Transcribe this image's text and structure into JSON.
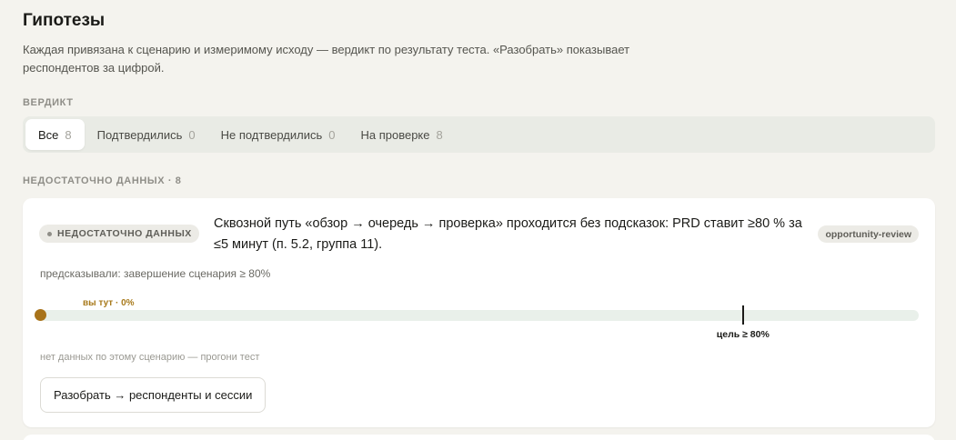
{
  "page": {
    "title": "Гипотезы",
    "description": "Каждая привязана к сценарию и измеримому исходу — вердикт по результату теста. «Разобрать» показывает респондентов за цифрой."
  },
  "verdict_filter": {
    "label": "ВЕРДИКТ",
    "tabs": [
      {
        "label": "Все",
        "count": "8",
        "active": true
      },
      {
        "label": "Подтвердились",
        "count": "0"
      },
      {
        "label": "Не подтвердились",
        "count": "0"
      },
      {
        "label": "На проверке",
        "count": "8"
      }
    ]
  },
  "group": {
    "label": "НЕДОСТАТОЧНО ДАННЫХ · 8"
  },
  "hypothesis": {
    "status": "НЕДОСТАТОЧНО ДАННЫХ",
    "title": "Сквозной путь «обзор → очередь → проверка» проходится без подсказок: PRD ставит ≥80 % за ≤5 минут (п. 5.2, группа 11).",
    "tag": "opportunity-review",
    "prediction": "предсказывали: завершение сценария ≥ 80%",
    "progress": {
      "current_value": 0,
      "target_value": 80,
      "max_value": 100,
      "current_label": "вы тут · 0%",
      "target_label": "цель ≥ 80%",
      "current_color": "#a8731a"
    },
    "no_data_note": "нет данных по этому сценарию — прогони тест",
    "drill_button": "Разобрать → респонденты и сессии"
  }
}
